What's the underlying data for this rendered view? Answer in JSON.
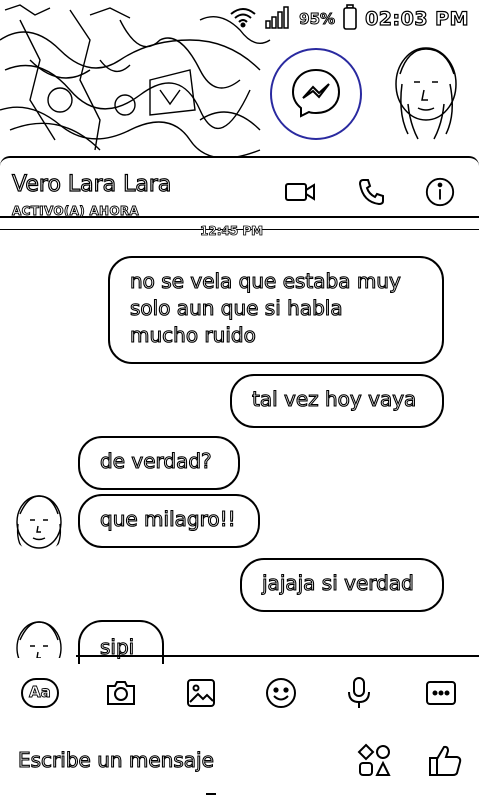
{
  "status_bar": {
    "battery": "95%",
    "time": "02:03 PM"
  },
  "header": {
    "name": "Vero Lara Lara",
    "status": "ACTIVO(A) AHORA"
  },
  "time_divider": "12:45 PM",
  "messages": [
    {
      "from": "me",
      "text_lines": [
        "no se vela que estaba muy",
        "solo aun que si habla",
        "mucho ruido"
      ]
    },
    {
      "from": "me",
      "text": "tal vez hoy vaya"
    },
    {
      "from": "them",
      "text": "de verdad?"
    },
    {
      "from": "them",
      "text": "que milagro!!"
    },
    {
      "from": "me",
      "text": "jajaja si verdad"
    },
    {
      "from": "them",
      "text": "sipi"
    }
  ],
  "composer": {
    "aa_label": "Aa",
    "placeholder": "Escribe un mensaje"
  },
  "icons": {
    "wifi": "wifi-icon",
    "signal": "signal-icon",
    "battery": "battery-icon",
    "messenger": "messenger-icon",
    "video": "video-call-icon",
    "phone": "phone-icon",
    "info": "info-icon",
    "camera": "camera-icon",
    "gallery": "gallery-icon",
    "emoji": "emoji-icon",
    "mic": "microphone-icon",
    "more": "more-icon",
    "apps": "apps-icon",
    "like": "thumbs-up-icon"
  }
}
